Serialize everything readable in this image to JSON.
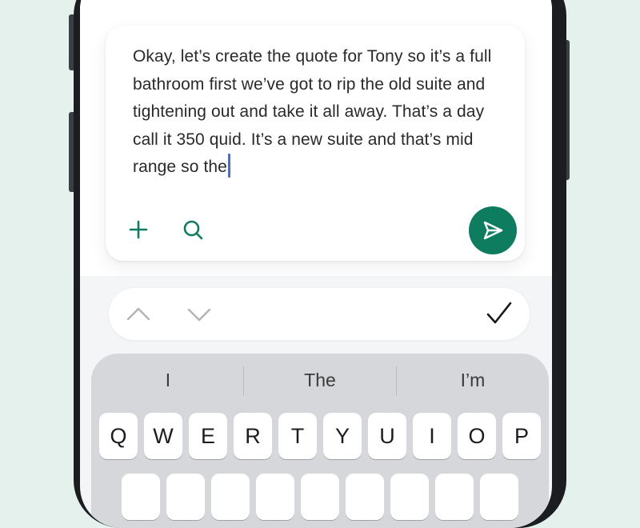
{
  "compose": {
    "message": "Okay, let’s create the quote for Tony so it’s a full bathroom first we’ve got to rip the old suite and tightening out and take it all away. That’s a day call it 350 quid. It’s a new suite and that’s mid range so the"
  },
  "icons": {
    "add": "plus-icon",
    "search": "search-icon",
    "send": "send-icon",
    "previous": "chevron-up-icon",
    "next": "chevron-down-icon",
    "done": "checkmark-icon"
  },
  "keyboard": {
    "suggestions": [
      "I",
      "The",
      "I’m"
    ],
    "row1": [
      "Q",
      "W",
      "E",
      "R",
      "T",
      "Y",
      "U",
      "I",
      "O",
      "P"
    ]
  },
  "colors": {
    "accent": "#0e7d5f",
    "background": "#e4f1ec",
    "caret": "#4a6ad8"
  }
}
